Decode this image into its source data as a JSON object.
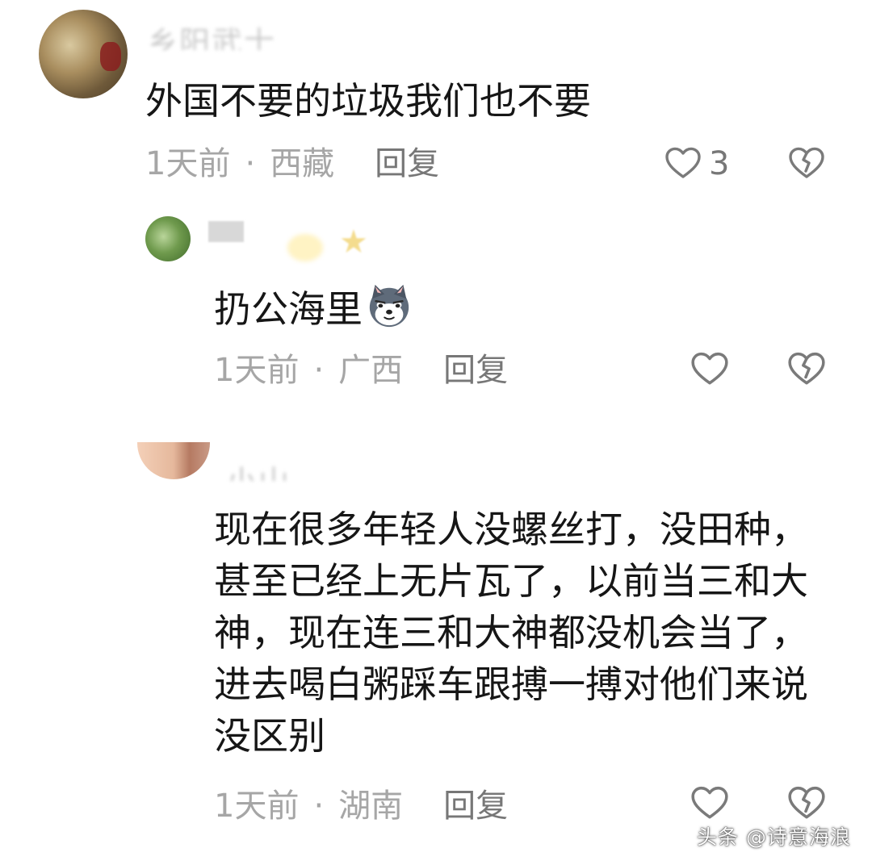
{
  "comments": [
    {
      "username": "乡阳武士",
      "text": "外国不要的垃圾我们也不要",
      "time": "1天前",
      "separator": "·",
      "location": "西藏",
      "reply_label": "回复",
      "like_count": "3"
    },
    {
      "text": "扔公海里",
      "emoji": "dog-emoji",
      "time": "1天前",
      "separator": "·",
      "location": "广西",
      "reply_label": "回复"
    },
    {
      "username": "小山",
      "text": "现在很多年轻人没螺丝打，没田种，甚至已经上无片瓦了，以前当三和大神，现在连三和大神都没机会当了，进去喝白粥踩车跟搏一搏对他们来说没区别",
      "time": "1天前",
      "separator": "·",
      "location": "湖南",
      "reply_label": "回复"
    }
  ],
  "watermark": "头条 @诗意海浪",
  "icons": {
    "like": "heart-outline-icon",
    "dislike": "broken-heart-icon"
  },
  "colors": {
    "text": "#161616",
    "meta": "#a6a6a6",
    "reply": "#777777",
    "background": "#ffffff"
  }
}
